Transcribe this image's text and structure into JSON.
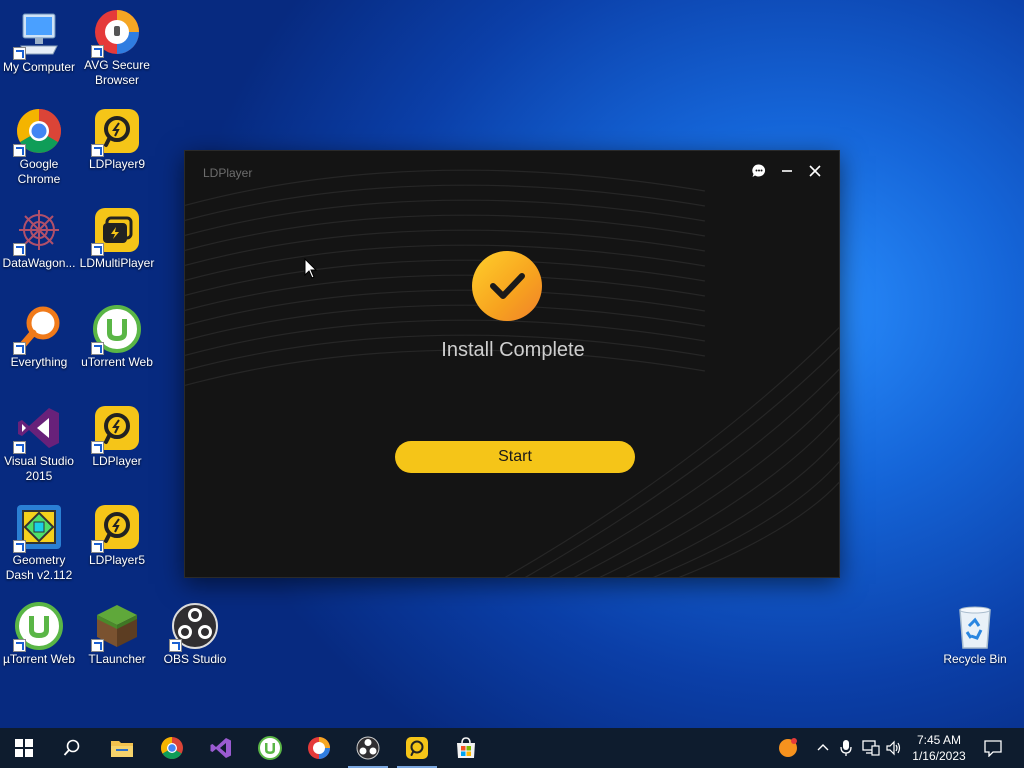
{
  "desktop": {
    "icons": [
      {
        "label": "My Computer",
        "icon": "computer-icon"
      },
      {
        "label": "AVG Secure Browser",
        "icon": "avg-browser-icon"
      },
      {
        "label": "Google Chrome",
        "icon": "chrome-icon"
      },
      {
        "label": "LDPlayer9",
        "icon": "ldplayer-icon"
      },
      {
        "label": "DataWagon...",
        "icon": "datawagon-icon"
      },
      {
        "label": "LDMultiPlayer",
        "icon": "ldmultiplayer-icon"
      },
      {
        "label": "Everything",
        "icon": "everything-search-icon"
      },
      {
        "label": "uTorrent Web",
        "icon": "utorrent-icon"
      },
      {
        "label": "Visual Studio 2015",
        "icon": "visual-studio-icon"
      },
      {
        "label": "LDPlayer",
        "icon": "ldplayer-icon"
      },
      {
        "label": "Geometry Dash v2.112",
        "icon": "geometry-dash-icon"
      },
      {
        "label": "LDPlayer5",
        "icon": "ldplayer-icon"
      },
      {
        "label": "µTorrent Web",
        "icon": "utorrent-icon"
      },
      {
        "label": "TLauncher",
        "icon": "minecraft-block-icon"
      },
      {
        "label": "OBS Studio",
        "icon": "obs-icon"
      },
      {
        "label": "Recycle Bin",
        "icon": "recycle-bin-icon"
      }
    ]
  },
  "window": {
    "title": "LDPlayer",
    "heading": "Install Complete",
    "start_label": "Start",
    "controls": [
      "feedback-icon",
      "minimize-icon",
      "close-icon"
    ],
    "colors": {
      "accent": "#f5c518",
      "background": "#141414"
    }
  },
  "taskbar": {
    "pinned": [
      "windows-start-icon",
      "search-icon",
      "file-explorer-icon",
      "chrome-icon",
      "visual-studio-icon",
      "utorrent-icon",
      "avg-browser-icon",
      "obs-icon",
      "ldplayer-icon",
      "microsoft-store-icon"
    ],
    "tray": [
      "orange-app-icon",
      "chevron-up-icon",
      "microphone-icon",
      "network-icon",
      "volume-icon"
    ],
    "time": "7:45 AM",
    "date": "1/16/2023",
    "notifications_icon": "notification-icon"
  }
}
